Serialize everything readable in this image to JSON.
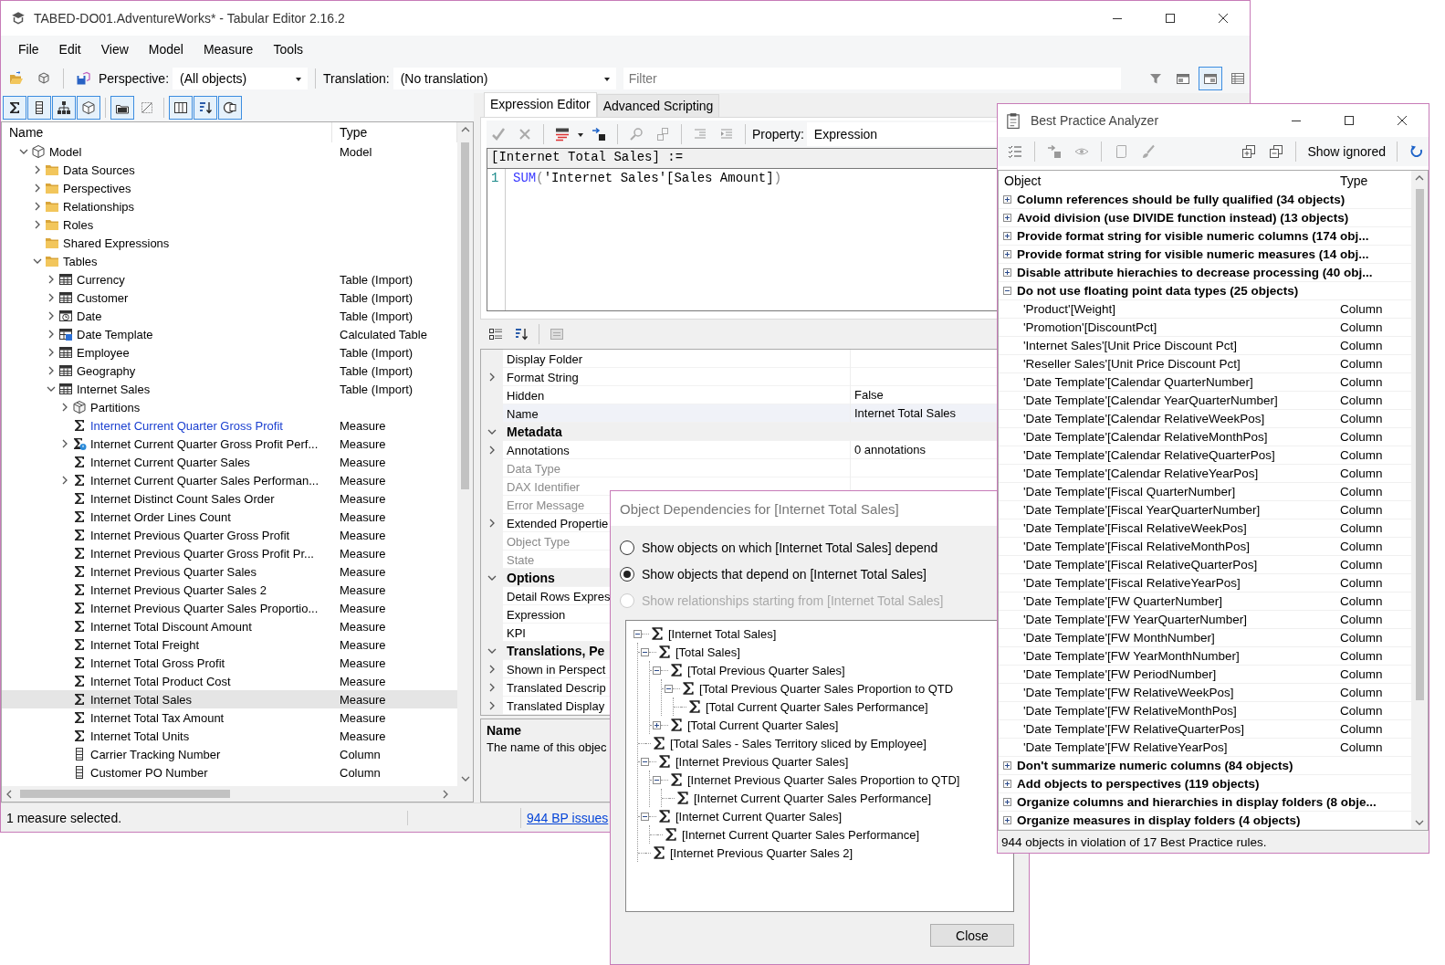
{
  "window": {
    "title": "TABED-DO01.AdventureWorks* - Tabular Editor 2.16.2"
  },
  "menu": [
    "File",
    "Edit",
    "View",
    "Model",
    "Measure",
    "Tools"
  ],
  "toolbar": {
    "perspective_label": "Perspective:",
    "perspective": "(All objects)",
    "translation_label": "Translation:",
    "translation": "(No translation)",
    "filter_placeholder": "Filter",
    "view_buttons": [
      {
        "pressed": false
      },
      {
        "pressed": false
      },
      {
        "pressed": true
      },
      {
        "pressed": false
      }
    ]
  },
  "object_toolbar": [
    {
      "pressed": true
    },
    {
      "pressed": true
    },
    {
      "pressed": true
    },
    {
      "pressed": true
    },
    {
      "pressed": true
    },
    {
      "pressed": false
    },
    {
      "pressed": true
    },
    {
      "pressed": true
    },
    {
      "pressed": true
    }
  ],
  "model_tree": {
    "columns": [
      "Name",
      "Type"
    ],
    "items": [
      {
        "name": "Model",
        "type": "Model",
        "kind": "model",
        "expanded": true,
        "selected": false,
        "children": [
          {
            "name": "Data Sources",
            "kind": "folder",
            "expanded": false,
            "selected": false
          },
          {
            "name": "Perspectives",
            "kind": "folder",
            "expanded": false,
            "selected": false
          },
          {
            "name": "Relationships",
            "kind": "folder",
            "expanded": false,
            "selected": false
          },
          {
            "name": "Roles",
            "kind": "folder",
            "expanded": false,
            "selected": false
          },
          {
            "name": "Shared Expressions",
            "kind": "folder",
            "selected": false
          },
          {
            "name": "Tables",
            "kind": "folder",
            "expanded": true,
            "selected": false,
            "children": [
              {
                "name": "Currency",
                "type": "Table (Import)",
                "kind": "table",
                "expanded": false,
                "selected": false
              },
              {
                "name": "Customer",
                "type": "Table (Import)",
                "kind": "table",
                "expanded": false,
                "selected": false
              },
              {
                "name": "Date",
                "type": "Table (Import)",
                "kind": "date-table",
                "expanded": false,
                "selected": false
              },
              {
                "name": "Date Template",
                "type": "Calculated Table",
                "kind": "calc-table",
                "expanded": false,
                "selected": false
              },
              {
                "name": "Employee",
                "type": "Table (Import)",
                "kind": "table",
                "expanded": false,
                "selected": false
              },
              {
                "name": "Geography",
                "type": "Table (Import)",
                "kind": "table",
                "expanded": false,
                "selected": false
              },
              {
                "name": "Internet Sales",
                "type": "Table (Import)",
                "kind": "table",
                "expanded": true,
                "selected": false,
                "children": [
                  {
                    "name": "Partitions",
                    "kind": "partitions",
                    "expanded": false,
                    "selected": false,
                    "hot": false
                  },
                  {
                    "name": "Internet Current Quarter Gross Profit",
                    "type": "Measure",
                    "kind": "measure",
                    "selected": false,
                    "hot": true
                  },
                  {
                    "name": "Internet Current Quarter Gross Profit Perf...",
                    "type": "Measure",
                    "kind": "kpi",
                    "expanded": false,
                    "selected": false,
                    "hot": false
                  },
                  {
                    "name": "Internet Current Quarter Sales",
                    "type": "Measure",
                    "kind": "measure",
                    "selected": false,
                    "hot": false
                  },
                  {
                    "name": "Internet Current Quarter Sales Performan...",
                    "type": "Measure",
                    "kind": "measure",
                    "expanded": false,
                    "selected": false,
                    "hot": false
                  },
                  {
                    "name": "Internet Distinct Count Sales Order",
                    "type": "Measure",
                    "kind": "measure",
                    "selected": false,
                    "hot": false
                  },
                  {
                    "name": "Internet Order Lines Count",
                    "type": "Measure",
                    "kind": "measure",
                    "selected": false,
                    "hot": false
                  },
                  {
                    "name": "Internet Previous Quarter Gross Profit",
                    "type": "Measure",
                    "kind": "measure",
                    "selected": false,
                    "hot": false
                  },
                  {
                    "name": "Internet Previous Quarter Gross Profit Pr...",
                    "type": "Measure",
                    "kind": "measure",
                    "selected": false,
                    "hot": false
                  },
                  {
                    "name": "Internet Previous Quarter Sales",
                    "type": "Measure",
                    "kind": "measure",
                    "selected": false,
                    "hot": false
                  },
                  {
                    "name": "Internet Previous Quarter Sales 2",
                    "type": "Measure",
                    "kind": "measure",
                    "selected": false,
                    "hot": false
                  },
                  {
                    "name": "Internet Previous Quarter Sales Proportio...",
                    "type": "Measure",
                    "kind": "measure",
                    "selected": false,
                    "hot": false
                  },
                  {
                    "name": "Internet Total Discount Amount",
                    "type": "Measure",
                    "kind": "measure",
                    "selected": false,
                    "hot": false
                  },
                  {
                    "name": "Internet Total Freight",
                    "type": "Measure",
                    "kind": "measure",
                    "selected": false,
                    "hot": false
                  },
                  {
                    "name": "Internet Total Gross Profit",
                    "type": "Measure",
                    "kind": "measure",
                    "selected": false,
                    "hot": false
                  },
                  {
                    "name": "Internet Total Product Cost",
                    "type": "Measure",
                    "kind": "measure",
                    "selected": false,
                    "hot": false
                  },
                  {
                    "name": "Internet Total Sales",
                    "type": "Measure",
                    "kind": "measure",
                    "selected": true,
                    "hot": false
                  },
                  {
                    "name": "Internet Total Tax Amount",
                    "type": "Measure",
                    "kind": "measure",
                    "selected": false,
                    "hot": false
                  },
                  {
                    "name": "Internet Total Units",
                    "type": "Measure",
                    "kind": "measure",
                    "selected": false,
                    "hot": false
                  },
                  {
                    "name": "Carrier Tracking Number",
                    "type": "Column",
                    "kind": "column",
                    "selected": false,
                    "hot": false
                  },
                  {
                    "name": "Customer PO Number",
                    "type": "Column",
                    "kind": "column",
                    "selected": false,
                    "hot": false
                  }
                ]
              }
            ]
          }
        ]
      }
    ]
  },
  "editor_tabs": [
    {
      "label": "Expression Editor",
      "selected": true
    },
    {
      "label": "Advanced Scripting",
      "selected": false
    }
  ],
  "expression_editor": {
    "property_label": "Property:",
    "property": "Expression",
    "header": "[Internet Total Sales] :=",
    "lines": [
      {
        "number": "1",
        "tokens": [
          {
            "kind": "function",
            "text": "SUM"
          },
          {
            "kind": "paren",
            "text": "("
          },
          {
            "kind": "plain",
            "text": "'Internet Sales'[Sales Amount]"
          },
          {
            "kind": "paren",
            "text": ")"
          }
        ]
      }
    ]
  },
  "properties": {
    "rows": [
      {
        "kind": "property",
        "name": "Display Folder",
        "disabled": false,
        "selected": false
      },
      {
        "kind": "property",
        "name": "Format String",
        "expanded": false,
        "disabled": false,
        "selected": false
      },
      {
        "kind": "property",
        "name": "Hidden",
        "value": "False",
        "disabled": false,
        "selected": false
      },
      {
        "kind": "property",
        "name": "Name",
        "value": "Internet Total Sales",
        "disabled": false,
        "selected": true
      },
      {
        "kind": "category",
        "name": "Metadata",
        "expanded": true
      },
      {
        "kind": "property",
        "name": "Annotations",
        "value": "0 annotations",
        "expanded": false,
        "disabled": false,
        "selected": false
      },
      {
        "kind": "property",
        "name": "Data Type",
        "disabled": true,
        "selected": false
      },
      {
        "kind": "property",
        "name": "DAX Identifier",
        "disabled": true,
        "selected": false
      },
      {
        "kind": "property",
        "name": "Error Message",
        "disabled": true,
        "selected": false
      },
      {
        "kind": "property",
        "name": "Extended Propertie",
        "expanded": false,
        "disabled": false,
        "selected": false
      },
      {
        "kind": "property",
        "name": "Object Type",
        "disabled": true,
        "selected": false
      },
      {
        "kind": "property",
        "name": "State",
        "disabled": true,
        "selected": false
      },
      {
        "kind": "category",
        "name": "Options",
        "expanded": true
      },
      {
        "kind": "property",
        "name": "Detail Rows Expres",
        "disabled": false,
        "selected": false
      },
      {
        "kind": "property",
        "name": "Expression",
        "disabled": false,
        "selected": false
      },
      {
        "kind": "property",
        "name": "KPI",
        "disabled": false,
        "selected": false
      },
      {
        "kind": "category",
        "name": "Translations, Pe",
        "expanded": true
      },
      {
        "kind": "property",
        "name": "Shown in Perspect",
        "expanded": false,
        "disabled": false,
        "selected": false
      },
      {
        "kind": "property",
        "name": "Translated Descrip",
        "expanded": false,
        "disabled": false,
        "selected": false
      },
      {
        "kind": "property",
        "name": "Translated Display",
        "expanded": false,
        "disabled": false,
        "selected": false
      }
    ],
    "description_title": "Name",
    "description": "The name of this objec"
  },
  "status_bar": {
    "message": "1 measure selected.",
    "link": "944 BP issues"
  },
  "dependencies_dialog": {
    "title": "Object Dependencies for [Internet Total Sales]",
    "options": [
      {
        "label": "Show objects on which [Internet Total Sales] depend",
        "selected": false,
        "disabled": false
      },
      {
        "label": "Show objects that depend on [Internet Total Sales]",
        "selected": true,
        "disabled": false
      },
      {
        "label": "Show relationships starting from [Internet Total Sales]",
        "selected": false,
        "disabled": true
      }
    ],
    "tree": [
      {
        "name": "[Internet Total Sales]",
        "expanded": true,
        "children": [
          {
            "name": "[Total Sales]",
            "expanded": true,
            "children": [
              {
                "name": "[Total Previous Quarter Sales]",
                "expanded": true,
                "children": [
                  {
                    "name": "[Total Previous Quarter Sales Proportion to QTD",
                    "expanded": true,
                    "children": [
                      {
                        "name": "[Total Current Quarter Sales Performance]"
                      }
                    ]
                  }
                ]
              },
              {
                "name": "[Total Current Quarter Sales]",
                "expanded": false
              }
            ]
          },
          {
            "name": "[Total Sales - Sales Territory sliced by Employee]"
          },
          {
            "name": "[Internet Previous Quarter Sales]",
            "expanded": true,
            "children": [
              {
                "name": "[Internet Previous Quarter Sales Proportion to QTD]",
                "expanded": true,
                "children": [
                  {
                    "name": "[Internet Current Quarter Sales Performance]"
                  }
                ]
              }
            ]
          },
          {
            "name": "[Internet Current Quarter Sales]",
            "expanded": true,
            "children": [
              {
                "name": "[Internet Current Quarter Sales Performance]"
              }
            ]
          },
          {
            "name": "[Internet Previous Quarter Sales 2]"
          }
        ]
      }
    ],
    "button": "Close"
  },
  "best_practice_analyzer": {
    "title": "Best Practice Analyzer",
    "show_ignored": "Show ignored",
    "columns": [
      "Object",
      "Type"
    ],
    "rules": [
      {
        "name": "Column references should be fully qualified (34 objects)",
        "expanded": false
      },
      {
        "name": "Avoid division (use DIVIDE function instead) (13 objects)",
        "expanded": false
      },
      {
        "name": "Provide format string for visible numeric columns (174 obj...",
        "expanded": false
      },
      {
        "name": "Provide format string for visible numeric measures (14 obj...",
        "expanded": false
      },
      {
        "name": "Disable attribute hierachies to decrease processing (40 obj...",
        "expanded": false
      },
      {
        "name": "Do not use floating point data types (25 objects)",
        "expanded": true,
        "children": [
          {
            "object": "'Product'[Weight]",
            "type": "Column"
          },
          {
            "object": "'Promotion'[DiscountPct]",
            "type": "Column"
          },
          {
            "object": "'Internet Sales'[Unit Price Discount Pct]",
            "type": "Column"
          },
          {
            "object": "'Reseller Sales'[Unit Price Discount Pct]",
            "type": "Column"
          },
          {
            "object": "'Date Template'[Calendar QuarterNumber]",
            "type": "Column"
          },
          {
            "object": "'Date Template'[Calendar YearQuarterNumber]",
            "type": "Column"
          },
          {
            "object": "'Date Template'[Calendar RelativeWeekPos]",
            "type": "Column"
          },
          {
            "object": "'Date Template'[Calendar RelativeMonthPos]",
            "type": "Column"
          },
          {
            "object": "'Date Template'[Calendar RelativeQuarterPos]",
            "type": "Column"
          },
          {
            "object": "'Date Template'[Calendar RelativeYearPos]",
            "type": "Column"
          },
          {
            "object": "'Date Template'[Fiscal QuarterNumber]",
            "type": "Column"
          },
          {
            "object": "'Date Template'[Fiscal YearQuarterNumber]",
            "type": "Column"
          },
          {
            "object": "'Date Template'[Fiscal RelativeWeekPos]",
            "type": "Column"
          },
          {
            "object": "'Date Template'[Fiscal RelativeMonthPos]",
            "type": "Column"
          },
          {
            "object": "'Date Template'[Fiscal RelativeQuarterPos]",
            "type": "Column"
          },
          {
            "object": "'Date Template'[Fiscal RelativeYearPos]",
            "type": "Column"
          },
          {
            "object": "'Date Template'[FW QuarterNumber]",
            "type": "Column"
          },
          {
            "object": "'Date Template'[FW YearQuarterNumber]",
            "type": "Column"
          },
          {
            "object": "'Date Template'[FW MonthNumber]",
            "type": "Column"
          },
          {
            "object": "'Date Template'[FW YearMonthNumber]",
            "type": "Column"
          },
          {
            "object": "'Date Template'[FW PeriodNumber]",
            "type": "Column"
          },
          {
            "object": "'Date Template'[FW RelativeWeekPos]",
            "type": "Column"
          },
          {
            "object": "'Date Template'[FW RelativeMonthPos]",
            "type": "Column"
          },
          {
            "object": "'Date Template'[FW RelativeQuarterPos]",
            "type": "Column"
          },
          {
            "object": "'Date Template'[FW RelativeYearPos]",
            "type": "Column"
          }
        ]
      },
      {
        "name": "Don't summarize numeric columns (84 objects)",
        "expanded": false
      },
      {
        "name": "Add objects to perspectives (119 objects)",
        "expanded": false
      },
      {
        "name": "Organize columns and hierarchies in display folders (8 obje...",
        "expanded": false
      },
      {
        "name": "Organize measures in display folders (4 objects)",
        "expanded": false
      }
    ],
    "status": "944 objects in violation of 17 Best Practice rules."
  }
}
